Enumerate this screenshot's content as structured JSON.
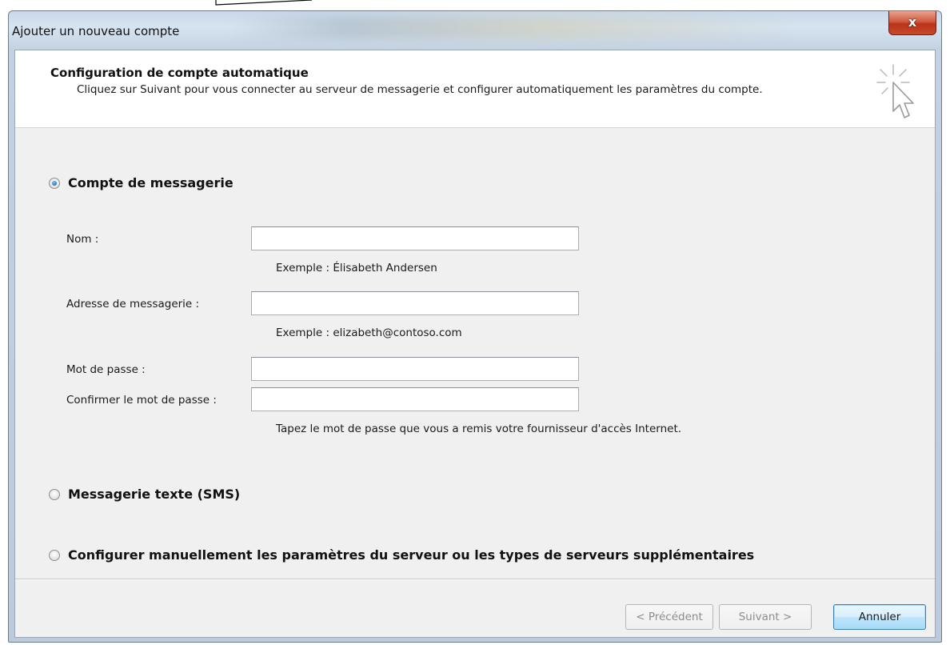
{
  "window": {
    "title": "Ajouter un nouveau compte",
    "close_label": "x"
  },
  "header": {
    "title": "Configuration de compte automatique",
    "description": "Cliquez sur Suivant pour vous connecter au serveur de messagerie et configurer automatiquement les paramètres du compte.",
    "icon": "wizard-cursor-icon"
  },
  "options": {
    "email_account": {
      "label": "Compte de messagerie",
      "selected": true
    },
    "sms": {
      "label": "Messagerie texte (SMS)",
      "selected": false
    },
    "manual": {
      "label": "Configurer manuellement les paramètres du serveur ou les types de serveurs supplémentaires",
      "selected": false
    }
  },
  "form": {
    "name": {
      "label": "Nom :",
      "value": "",
      "hint": "Exemple : Élisabeth Andersen"
    },
    "email": {
      "label": "Adresse de messagerie :",
      "value": "",
      "hint": "Exemple : elizabeth@contoso.com"
    },
    "password": {
      "label": "Mot de passe :",
      "value": ""
    },
    "confirm_password": {
      "label": "Confirmer le mot de passe :",
      "value": "",
      "hint": "Tapez le mot de passe que vous a remis votre fournisseur d'accès Internet."
    }
  },
  "buttons": {
    "previous": {
      "label": "< Précédent",
      "enabled": false
    },
    "next": {
      "label": "Suivant >",
      "enabled": false
    },
    "cancel": {
      "label": "Annuler",
      "enabled": true
    }
  },
  "colors": {
    "accent_radio": "#2376c4",
    "close_button": "#c9482c",
    "default_button_border": "#3c7fb1"
  }
}
